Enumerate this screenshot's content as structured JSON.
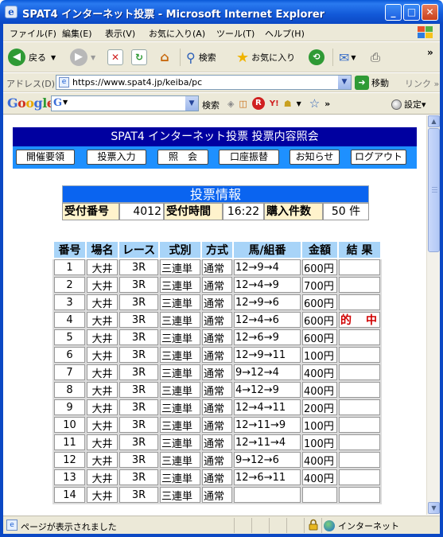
{
  "window": {
    "title": "SPAT4 インターネット投票 - Microsoft Internet Explorer",
    "app_icon": "ie-icon"
  },
  "menu": [
    "ファイル(F)",
    "編集(E)",
    "表示(V)",
    "お気に入り(A)",
    "ツール(T)",
    "ヘルプ(H)"
  ],
  "toolbar": {
    "back": "戻る",
    "search": "検索",
    "favorites": "お気に入り",
    "overflow": "»"
  },
  "address": {
    "label": "アドレス(D)",
    "url": "https://www.spat4.jp/keiba/pc",
    "go": "移動",
    "links": "リンク »"
  },
  "google": {
    "logo": "Google",
    "field_mark": "G",
    "search": "検索",
    "overflow": "»",
    "settings": "設定▾"
  },
  "page": {
    "header": "SPAT4 インターネット投票 投票内容照会",
    "nav": [
      "開催要領",
      "投票入力",
      "照　会",
      "口座振替",
      "お知らせ",
      "ログアウト"
    ],
    "info": {
      "title": "投票情報",
      "receipt_label": "受付番号",
      "receipt_value": "4012",
      "time_label": "受付時間",
      "time_value": "16:22",
      "count_label": "購入件数",
      "count_value": "50 件"
    },
    "table": {
      "headers": [
        "番号",
        "場名",
        "レース",
        "式別",
        "方式",
        "馬/組番",
        "金額",
        "結 果"
      ],
      "rows": [
        [
          "1",
          "大井",
          "3R",
          "三連単",
          "通常",
          "12→9→4",
          "600円",
          ""
        ],
        [
          "2",
          "大井",
          "3R",
          "三連単",
          "通常",
          "12→4→9",
          "700円",
          ""
        ],
        [
          "3",
          "大井",
          "3R",
          "三連単",
          "通常",
          "12→9→6",
          "600円",
          ""
        ],
        [
          "4",
          "大井",
          "3R",
          "三連単",
          "通常",
          "12→4→6",
          "600円",
          "的　中"
        ],
        [
          "5",
          "大井",
          "3R",
          "三連単",
          "通常",
          "12→6→9",
          "600円",
          ""
        ],
        [
          "6",
          "大井",
          "3R",
          "三連単",
          "通常",
          "12→9→11",
          "100円",
          ""
        ],
        [
          "7",
          "大井",
          "3R",
          "三連単",
          "通常",
          "9→12→4",
          "400円",
          ""
        ],
        [
          "8",
          "大井",
          "3R",
          "三連単",
          "通常",
          "4→12→9",
          "400円",
          ""
        ],
        [
          "9",
          "大井",
          "3R",
          "三連単",
          "通常",
          "12→4→11",
          "200円",
          ""
        ],
        [
          "10",
          "大井",
          "3R",
          "三連単",
          "通常",
          "12→11→9",
          "100円",
          ""
        ],
        [
          "11",
          "大井",
          "3R",
          "三連単",
          "通常",
          "12→11→4",
          "100円",
          ""
        ],
        [
          "12",
          "大井",
          "3R",
          "三連単",
          "通常",
          "9→12→6",
          "400円",
          ""
        ],
        [
          "13",
          "大井",
          "3R",
          "三連単",
          "通常",
          "12→6→11",
          "400円",
          ""
        ],
        [
          "14",
          "大井",
          "3R",
          "三連単",
          "通常",
          "",
          "",
          ""
        ]
      ]
    }
  },
  "status": {
    "message": "ページが表示されました",
    "zone": "インターネット"
  },
  "colors": {
    "header_bg": "#0000a0",
    "nav_bg": "#1e90ff",
    "info_title_bg": "#0a64f0",
    "label_bg": "#fff3cc",
    "table_header_bg": "#a8d4f8",
    "hit_text": "#d00000"
  }
}
